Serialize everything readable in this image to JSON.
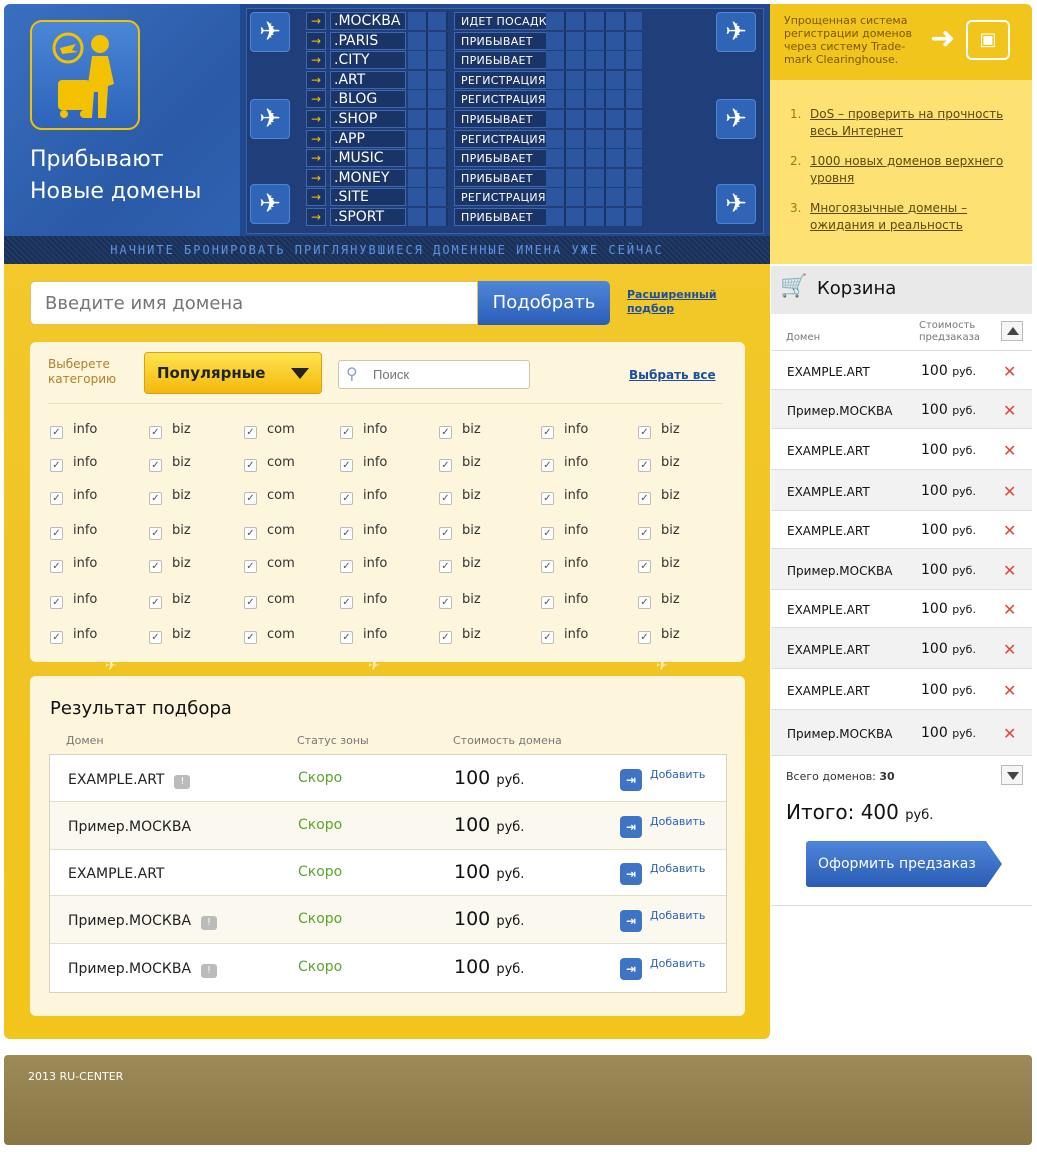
{
  "hero": {
    "title_line1": "Прибывают",
    "title_line2": "Новые домены"
  },
  "board": {
    "rows": [
      {
        "domain": ".МОСКВА",
        "status": "ИДЕТ ПОСАДКА"
      },
      {
        "domain": ".PARIS",
        "status": "ПРИБЫВАЕТ"
      },
      {
        "domain": ".CITY",
        "status": "ПРИБЫВАЕТ"
      },
      {
        "domain": ".ART",
        "status": "РЕГИСТРАЦИЯ"
      },
      {
        "domain": ".BLOG",
        "status": "РЕГИСТРАЦИЯ"
      },
      {
        "domain": ".SHOP",
        "status": "ПРИБЫВАЕТ"
      },
      {
        "domain": ".APP",
        "status": "РЕГИСТРАЦИЯ"
      },
      {
        "domain": ".MUSIC",
        "status": "ПРИБЫВАЕТ"
      },
      {
        "domain": ".MONEY",
        "status": "ПРИБЫВАЕТ"
      },
      {
        "domain": ".SITE",
        "status": "РЕГИСТРАЦИЯ"
      },
      {
        "domain": ".SPORT",
        "status": "ПРИБЫВАЕТ"
      }
    ],
    "tagline": "НАЧНИТЕ БРОНИРОВАТЬ ПРИГЛЯНУВШИЕСЯ ДОМЕННЫЕ ИМЕНА УЖЕ СЕЙЧАС"
  },
  "promo": {
    "text": "Упрощенная система регистрации доменов через систему Trade-mark Clearinghouse."
  },
  "news": [
    {
      "num": "1.",
      "text": "DoS – проверить на прочность весь Интернет"
    },
    {
      "num": "2.",
      "text": "1000 новых доменов верхнего уровня"
    },
    {
      "num": "3.",
      "text": "Многоязычные домены – ожидания и реальность"
    }
  ],
  "search": {
    "placeholder": "Введите имя домена",
    "button": "Подобрать",
    "advanced": "Расширенный подбор"
  },
  "categories": {
    "label": "Выберете категорию",
    "selected": "Популярные",
    "filter_placeholder": "Поиск",
    "select_all": "Выбрать все",
    "columns": [
      "info",
      "biz",
      "com",
      "info",
      "biz",
      "info",
      "biz"
    ]
  },
  "results": {
    "title": "Результат подбора",
    "headers": {
      "domain": "Домен",
      "status": "Статус зоны",
      "price": "Стоимость домена"
    },
    "add_label": "Добавить",
    "rows": [
      {
        "domain": "EXAMPLE.ART",
        "badge": "!",
        "status": "Скоро",
        "price": "100",
        "currency": "руб."
      },
      {
        "domain": "Пример.МОСКВА",
        "badge": "",
        "status": "Скоро",
        "price": "100",
        "currency": "руб."
      },
      {
        "domain": "EXAMPLE.ART",
        "badge": "",
        "status": "Скоро",
        "price": "100",
        "currency": "руб."
      },
      {
        "domain": "Пример.МОСКВА",
        "badge": "!",
        "status": "Скоро",
        "price": "100",
        "currency": "руб."
      },
      {
        "domain": "Пример.МОСКВА",
        "badge": "!",
        "status": "Скоро",
        "price": "100",
        "currency": "руб."
      }
    ]
  },
  "cart": {
    "title": "Корзина",
    "col_domain": "Домен",
    "col_price": "Стоимость предзаказа",
    "items": [
      {
        "domain": "EXAMPLE.ART",
        "price": "100",
        "currency": "руб."
      },
      {
        "domain": "Пример.МОСКВА",
        "price": "100",
        "currency": "руб."
      },
      {
        "domain": "EXAMPLE.ART",
        "price": "100",
        "currency": "руб."
      },
      {
        "domain": "EXAMPLE.ART",
        "price": "100",
        "currency": "руб."
      },
      {
        "domain": "EXAMPLE.ART",
        "price": "100",
        "currency": "руб."
      },
      {
        "domain": "Пример.МОСКВА",
        "price": "100",
        "currency": "руб."
      },
      {
        "domain": "EXAMPLE.ART",
        "price": "100",
        "currency": "руб."
      },
      {
        "domain": "EXAMPLE.ART",
        "price": "100",
        "currency": "руб."
      },
      {
        "domain": "EXAMPLE.ART",
        "price": "100",
        "currency": "руб."
      },
      {
        "domain": "Пример.МОСКВА",
        "price": "100",
        "currency": "руб."
      }
    ],
    "total_domains_label": "Всего доменов:",
    "total_domains": "30",
    "total_label": "Итого:",
    "total": "400",
    "total_currency": "руб.",
    "order_button": "Оформить предзаказ"
  },
  "footer": {
    "copyright": "2013 RU-CENTER"
  },
  "colors": {
    "yellow": "#f2c51c",
    "blue": "#2b5eb8",
    "green": "#5ca62a",
    "red": "#e0473c"
  }
}
